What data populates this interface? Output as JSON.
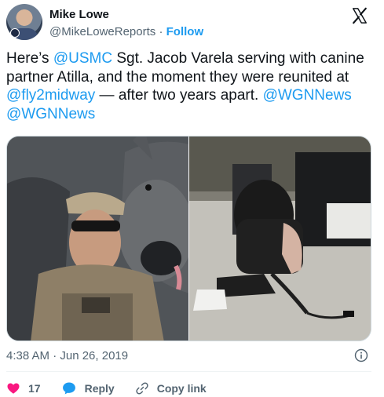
{
  "author": {
    "name": "Mike Lowe",
    "handle": "@MikeLoweReports",
    "separator": "·",
    "follow_label": "Follow"
  },
  "tweet": {
    "segments": [
      {
        "text": "Here’s ",
        "link": false
      },
      {
        "text": "@USMC",
        "link": true
      },
      {
        "text": " Sgt. Jacob Varela serving with canine partner Atilla, and the moment they were reunited at ",
        "link": false
      },
      {
        "text": "@fly2midway",
        "link": true
      },
      {
        "text": " — after two years apart. ",
        "link": false
      },
      {
        "text": "@WGNNews",
        "link": true
      },
      {
        "text": " ",
        "link": false
      },
      {
        "text": "@WGNNews",
        "link": true
      }
    ]
  },
  "timestamp": "4:38 AM · Jun 26, 2019",
  "actions": {
    "like_count": "17",
    "reply_label": "Reply",
    "copy_label": "Copy link"
  },
  "icons": {
    "logo": "x-logo-icon",
    "info": "info-icon",
    "like": "heart-icon",
    "reply": "reply-bubble-icon",
    "copy": "link-icon"
  },
  "colors": {
    "link": "#1d9bf0",
    "muted": "#536471",
    "like": "#f91880",
    "text": "#0f1419"
  }
}
